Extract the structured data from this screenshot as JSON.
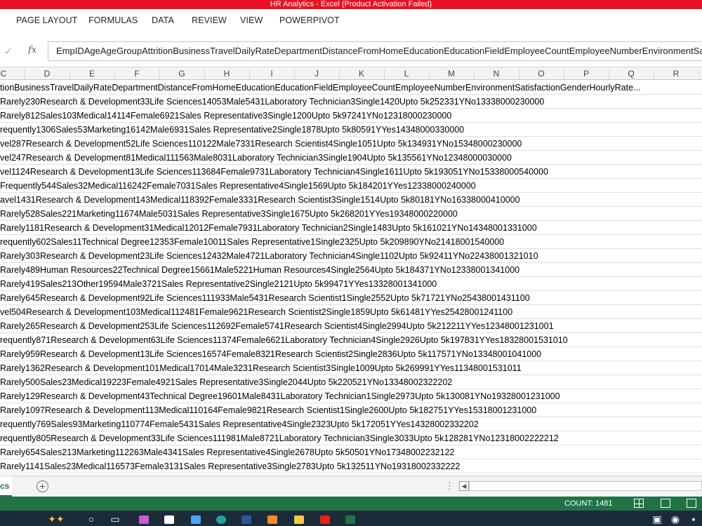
{
  "window": {
    "title": "HR Analytics -  Excel (Product Activation Failed)"
  },
  "ribbon": {
    "tabs": [
      "PAGE LAYOUT",
      "FORMULAS",
      "DATA",
      "REVIEW",
      "VIEW",
      "POWERPIVOT"
    ]
  },
  "formula_bar": {
    "fx_label": "fx",
    "value": "EmpIDAgeAgeGroupAttritionBusinessTravelDailyRateDepartmentDistanceFromHomeEducationEducationFieldEmployeeCountEmployeeNumberEnvironmentSatisfactionGenderHourlyRate"
  },
  "columns": [
    "C",
    "D",
    "E",
    "F",
    "G",
    "H",
    "I",
    "J",
    "K",
    "L",
    "M",
    "N",
    "O",
    "P",
    "Q",
    "R"
  ],
  "rows": [
    "tionBusinessTravelDailyRateDepartmentDistanceFromHomeEducationEducationFieldEmployeeCountEmployeeNumberEnvironmentSatisfactionGenderHourlyRate...",
    "Rarely230Research & Development33Life Sciences14053Male5431Laboratory Technician3Single1420Upto 5k252331YNo13338000230000",
    "Rarely812Sales103Medical14114Female6921Sales Representative3Single1200Upto 5k97241YNo12318000230000",
    "requently1306Sales53Marketing16142Male6931Sales Representative2Single1878Upto 5k80591YYes14348000330000",
    "vel287Research & Development52Life Sciences110122Male7331Research Scientist4Single1051Upto 5k134931YNo15348000230000",
    "vel247Research & Development81Medical111563Male8031Laboratory Technician3Single1904Upto 5k135561YNo12348000030000",
    "vel1124Research & Development13Life Sciences113684Female9731Laboratory Technician4Single1611Upto 5k193051YNo15338000540000",
    "Frequently544Sales32Medical116242Female7031Sales Representative4Single1569Upto 5k184201YYes12338000240000",
    "avel1431Research & Development143Medical118392Female3331Research Scientist3Single1514Upto 5k80181YNo16338000410000",
    "Rarely528Sales221Marketing11674Male5031Sales Representative3Single1675Upto 5k268201YYes19348000220000",
    "Rarely1181Research & Development31Medical12012Female7931Laboratory Technician2Single1483Upto 5k161021YNo14348001331000",
    "requently602Sales11Technical Degree12353Female10011Sales Representative1Single2325Upto 5k209890YNo21418001540000",
    "Rarely303Research & Development23Life Sciences12432Male4721Laboratory Technician4Single1102Upto 5k92411YNo22438001321010",
    "Rarely489Human Resources22Technical Degree15661Male5221Human Resources4Single2564Upto 5k184371YNo12338001341000",
    "Rarely419Sales213Other19594Male3721Sales Representative2Single2121Upto 5k99471YYes13328001341000",
    "Rarely645Research & Development92Life Sciences111933Male5431Research Scientist1Single2552Upto 5k71721YNo25438001431100",
    "vel504Research & Development103Medical112481Female9621Research Scientist2Single1859Upto 5k61481YYes25428001241100",
    "Rarely265Research & Development253Life Sciences112692Female5741Research Scientist4Single2994Upto 5k212211YYes12348001231001",
    "requently871Research & Development63Life Sciences11374Female6621Laboratory Technician4Single2926Upto 5k197831YYes18328001531010",
    "Rarely959Research & Development13Life Sciences16574Female8321Research Scientist2Single2836Upto 5k117571YNo13348001041000",
    "Rarely1362Research & Development101Medical17014Male3231Research Scientist3Single1009Upto 5k269991YYes11348001531011",
    "Rarely500Sales23Medical19223Female4921Sales Representative3Single2044Upto 5k220521YNo13348002322202",
    "Rarely129Research & Development43Technical Degree19601Male8431Laboratory Technician1Single2973Upto 5k130081YNo19328001231000",
    "Rarely1097Research & Development113Medical110164Female9821Research Scientist1Single2600Upto 5k182751YYes15318001231000",
    "requently769Sales93Marketing110774Female5431Sales Representative4Single2323Upto 5k172051YYes14328002332202",
    "requently805Research & Development33Life Sciences111981Male8721Laboratory Technician3Single3033Upto 5k128281YNo12318002222212",
    "Rarely654Sales213Marketing112263Male4341Sales Representative4Single2678Upto 5k50501YNo17348002232122",
    "Rarely1141Sales23Medical116573Female3131Sales Representative3Single2783Upto 5k132511YNo19318002332222"
  ],
  "sheet": {
    "active_tab": "cs",
    "add_symbol": "+"
  },
  "status": {
    "count": "COUNT: 1481"
  }
}
